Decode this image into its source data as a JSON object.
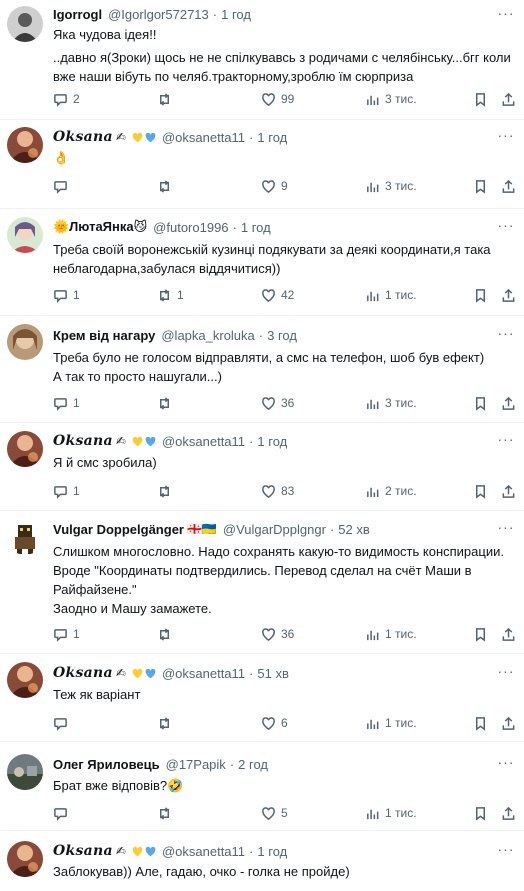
{
  "replies": [
    {
      "name": "Igorrogl",
      "handle": "@Igorlgor572713",
      "time": "1 год",
      "text_lines": [
        "Яка чудова ідея!!",
        "..давно я(Зроки) щось не не спілкувавсь з родичами с челябінську...бгг коли вже наши вібуть по челяб.тракторному,зроблю їм сюрприза"
      ],
      "replies": "2",
      "retweets": "",
      "likes": "99",
      "views": "3 тис."
    },
    {
      "name": "Oksana",
      "name_suffix": "✍",
      "handle": "@oksanetta11",
      "time": "1 год",
      "text_lines": [
        "👌"
      ],
      "replies": "",
      "retweets": "",
      "likes": "9",
      "views": "3 тис."
    },
    {
      "name": "🌞ЛютаЯнка😼",
      "handle": "@futoro1996",
      "time": "1 год",
      "text_lines": [
        "Треба своїй воронежській кузинці подякувати за деякі координати,я така неблагодарна,забулася віддячитися))"
      ],
      "replies": "1",
      "retweets": "1",
      "likes": "42",
      "views": "1 тис."
    },
    {
      "name": "Крем від нагару",
      "handle": "@lapka_kroluka",
      "time": "3 год",
      "text_lines": [
        "Треба було не голосом відправляти, а смс на телефон, шоб був ефект)",
        "А так то просто нашугали...)"
      ],
      "replies": "1",
      "retweets": "",
      "likes": "36",
      "views": "3 тис."
    },
    {
      "name": "Oksana",
      "name_suffix": "✍",
      "handle": "@oksanetta11",
      "time": "1 год",
      "text_lines": [
        "Я й смс зробила)"
      ],
      "replies": "1",
      "retweets": "",
      "likes": "83",
      "views": "2 тис."
    },
    {
      "name": "Vulgar Doppelgänger",
      "flags": "🇬🇪🇺🇦",
      "handle": "@VulgarDpplgngr",
      "time": "52 хв",
      "text_lines": [
        "Слишком многословно. Надо сохранять какую-то видимость конспирации. Вроде \"Координаты подтвердились. Перевод сделал на счёт Маши в Райфайзене.\"",
        "Заодно и Машу замажете."
      ],
      "replies": "1",
      "retweets": "",
      "likes": "36",
      "views": "1 тис."
    },
    {
      "name": "Oksana",
      "name_suffix": "✍",
      "handle": "@oksanetta11",
      "time": "51 хв",
      "text_lines": [
        "Теж як варіант"
      ],
      "replies": "",
      "retweets": "",
      "likes": "6",
      "views": "1 тис."
    },
    {
      "name": "Олег Яриловець",
      "handle": "@17Papik",
      "time": "2 год",
      "text_lines": [
        "Брат вже відповів?🤣"
      ],
      "replies": "",
      "retweets": "",
      "likes": "5",
      "views": "1 тис."
    },
    {
      "name": "Oksana",
      "name_suffix": "✍",
      "handle": "@oksanetta11",
      "time": "1 год",
      "text_lines": [
        "Заблокував)) Але, гадаю, очко - голка не пройде)"
      ],
      "replies": "",
      "retweets": "",
      "likes": "",
      "views": ""
    }
  ],
  "colors": {
    "yellow_heart": "#ffcc33",
    "blue_heart": "#5aa9e6",
    "muted": "#536471",
    "divider": "#eff3f4"
  }
}
